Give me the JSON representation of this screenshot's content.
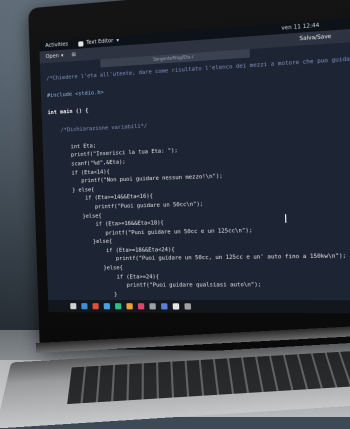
{
  "topbar": {
    "activities": "Activities",
    "app_name": "Text Editor",
    "app_menu_arrow": "▾",
    "clock": "ven 11 12:44"
  },
  "headerbar": {
    "open_label": "Open",
    "open_arrow": "▾",
    "save_label": "Salva/Save"
  },
  "file_tab": "SorgenteProg/Eta.c",
  "code_lines": [
    {
      "cls": "c-comment",
      "text": "/*Chiedere l'eta all'utente, dare come risultato l'elenco dei mezzi a motore che puo guidare */"
    },
    {
      "cls": "c-pre",
      "text": ""
    },
    {
      "cls": "c-pre",
      "text": "#include <stdio.h>"
    },
    {
      "cls": "",
      "text": ""
    },
    {
      "cls": "c-key",
      "text": "int main () {"
    },
    {
      "cls": "",
      "text": ""
    },
    {
      "cls": "c-comment",
      "text": "    /*Dichiarazione variabili*/"
    },
    {
      "cls": "",
      "text": ""
    },
    {
      "cls": "",
      "text": "       int Eta;"
    },
    {
      "cls": "",
      "text": "       printf(\"Inserisci la tua Eta: \");"
    },
    {
      "cls": "",
      "text": "       scanf(\"%d\",&Eta);"
    },
    {
      "cls": "",
      "text": "       if (Eta<14){"
    },
    {
      "cls": "",
      "text": "          printf(\"Non puoi guidare nessun mezzo!\\n\");"
    },
    {
      "cls": "",
      "text": "       } else{"
    },
    {
      "cls": "",
      "text": "           if (Eta>=14&&Eta<16){"
    },
    {
      "cls": "",
      "text": "              printf(\"Puoi guidare un 50cc\\n\");"
    },
    {
      "cls": "",
      "text": "          }else{"
    },
    {
      "cls": "",
      "text": "              if (Eta>=16&&Eta<18){"
    },
    {
      "cls": "",
      "text": "                 printf(\"Puoi guidare un 50cc e un 125cc\\n\");"
    },
    {
      "cls": "",
      "text": "             }else{"
    },
    {
      "cls": "",
      "text": "                 if (Eta>=18&&Eta<24){"
    },
    {
      "cls": "",
      "text": "                    printf(\"Puoi guidare un 50cc, un 125cc e un' auto fino a 150kw\\n\");"
    },
    {
      "cls": "",
      "text": "                }else{"
    },
    {
      "cls": "",
      "text": "                    if (Eta>=24){"
    },
    {
      "cls": "",
      "text": "                       printf(\"Puoi guidare qualsiasi auto\\n\");"
    },
    {
      "cls": "",
      "text": "                   }"
    },
    {
      "cls": "",
      "text": "                }"
    },
    {
      "cls": "",
      "text": "             }"
    }
  ],
  "dock_icons": [
    {
      "name": "terminal-icon",
      "color": "#d0d0d0"
    },
    {
      "name": "files-icon",
      "color": "#3a8fd8"
    },
    {
      "name": "browser-icon",
      "color": "#e34d3c"
    },
    {
      "name": "mail-icon",
      "color": "#4aa3df"
    },
    {
      "name": "music-icon",
      "color": "#28c08a"
    },
    {
      "name": "photos-icon",
      "color": "#f0a030"
    },
    {
      "name": "store-icon",
      "color": "#e3446e"
    },
    {
      "name": "settings-icon",
      "color": "#9aa0a8"
    },
    {
      "name": "editor-icon",
      "color": "#5a7fd8"
    },
    {
      "name": "calendar-icon",
      "color": "#e6e6e6"
    },
    {
      "name": "trash-icon",
      "color": "#a0a0a0"
    }
  ]
}
